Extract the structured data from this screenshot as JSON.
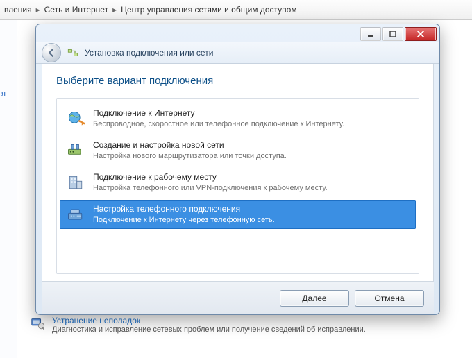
{
  "breadcrumb": {
    "item0": "вления",
    "item1": "Сеть и Интернет",
    "item2": "Центр управления сетями и общим доступом"
  },
  "bg_sidebar": {
    "fragment": "я"
  },
  "bg_troubleshoot": {
    "title": "Устранение неполадок",
    "desc": "Диагностика и исправление сетевых проблем или получение сведений об исправлении."
  },
  "dialog": {
    "title": "Установка подключения или сети",
    "instruction": "Выберите вариант подключения",
    "options": [
      {
        "title": "Подключение к Интернету",
        "desc": "Беспроводное, скоростное или телефонное подключение к Интернету.",
        "selected": false
      },
      {
        "title": "Создание и настройка новой сети",
        "desc": "Настройка нового маршрутизатора или точки доступа.",
        "selected": false
      },
      {
        "title": "Подключение к рабочему месту",
        "desc": "Настройка телефонного или VPN-подключения к рабочему месту.",
        "selected": false
      },
      {
        "title": "Настройка телефонного подключения",
        "desc": "Подключение к Интернету через телефонную сеть.",
        "selected": true
      }
    ],
    "buttons": {
      "next": "Далее",
      "cancel": "Отмена"
    }
  }
}
